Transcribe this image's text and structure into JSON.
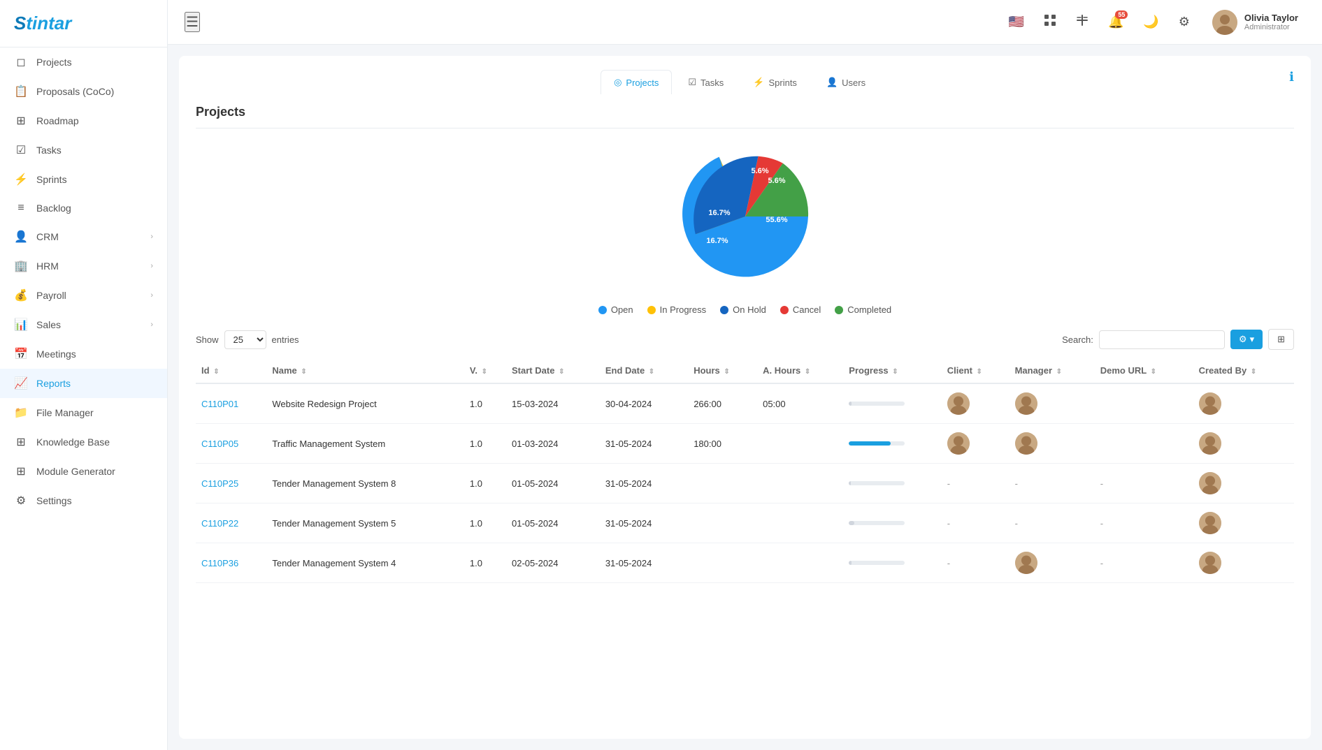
{
  "app": {
    "name": "Stintar"
  },
  "header": {
    "hamburger_label": "☰",
    "notification_count": "55",
    "user": {
      "name": "Olivia Taylor",
      "role": "Administrator"
    }
  },
  "sidebar": {
    "items": [
      {
        "id": "projects",
        "label": "Projects",
        "icon": "◻",
        "active": false
      },
      {
        "id": "proposals",
        "label": "Proposals (CoCo)",
        "icon": "📋",
        "active": false
      },
      {
        "id": "roadmap",
        "label": "Roadmap",
        "icon": "⊞",
        "active": false
      },
      {
        "id": "tasks",
        "label": "Tasks",
        "icon": "☑",
        "active": false
      },
      {
        "id": "sprints",
        "label": "Sprints",
        "icon": "⚡",
        "active": false
      },
      {
        "id": "backlog",
        "label": "Backlog",
        "icon": "≡",
        "active": false
      },
      {
        "id": "crm",
        "label": "CRM",
        "icon": "👤",
        "hasChevron": true,
        "active": false
      },
      {
        "id": "hrm",
        "label": "HRM",
        "icon": "🏢",
        "hasChevron": true,
        "active": false
      },
      {
        "id": "payroll",
        "label": "Payroll",
        "icon": "💰",
        "hasChevron": true,
        "active": false
      },
      {
        "id": "sales",
        "label": "Sales",
        "icon": "📊",
        "hasChevron": true,
        "active": false
      },
      {
        "id": "meetings",
        "label": "Meetings",
        "icon": "📅",
        "active": false
      },
      {
        "id": "reports",
        "label": "Reports",
        "icon": "📈",
        "active": true
      },
      {
        "id": "file-manager",
        "label": "File Manager",
        "icon": "📁",
        "active": false
      },
      {
        "id": "knowledge-base",
        "label": "Knowledge Base",
        "icon": "⊞",
        "active": false
      },
      {
        "id": "module-generator",
        "label": "Module Generator",
        "icon": "⊞",
        "active": false
      },
      {
        "id": "settings",
        "label": "Settings",
        "icon": "⚙",
        "active": false
      }
    ]
  },
  "tabs": [
    {
      "id": "projects",
      "label": "Projects",
      "icon": "◎",
      "active": true
    },
    {
      "id": "tasks",
      "label": "Tasks",
      "icon": "☑",
      "active": false
    },
    {
      "id": "sprints",
      "label": "Sprints",
      "icon": "⚡",
      "active": false
    },
    {
      "id": "users",
      "label": "Users",
      "icon": "👤",
      "active": false
    }
  ],
  "section": {
    "title": "Projects"
  },
  "chart": {
    "segments": [
      {
        "label": "Open",
        "percent": 55.6,
        "color": "#2196f3"
      },
      {
        "label": "In Progress",
        "percent": 16.7,
        "color": "#ffc107"
      },
      {
        "label": "On Hold",
        "percent": 16.7,
        "color": "#1565c0"
      },
      {
        "label": "Cancel",
        "percent": 5.6,
        "color": "#e53935"
      },
      {
        "label": "Completed",
        "percent": 5.6,
        "color": "#43a047"
      }
    ]
  },
  "table": {
    "show_label": "Show",
    "show_value": "25",
    "entries_label": "entries",
    "search_label": "Search:",
    "search_placeholder": "",
    "columns": [
      "Id",
      "Name",
      "V.",
      "Start Date",
      "End Date",
      "Hours",
      "A. Hours",
      "Progress",
      "Client",
      "Manager",
      "Demo URL",
      "Created By"
    ],
    "rows": [
      {
        "id": "C110P01",
        "name": "Website Redesign Project",
        "v": "1.0",
        "start": "15-03-2024",
        "end": "30-04-2024",
        "hours": "266:00",
        "a_hours": "05:00",
        "progress": 5,
        "has_client": true,
        "has_manager": true,
        "demo_url": "",
        "has_created": true
      },
      {
        "id": "C110P05",
        "name": "Traffic Management System",
        "v": "1.0",
        "start": "01-03-2024",
        "end": "31-05-2024",
        "hours": "180:00",
        "a_hours": "",
        "progress": 75,
        "progress_color": "#1a9fe0",
        "has_client": true,
        "has_manager": true,
        "demo_url": "",
        "has_created": true
      },
      {
        "id": "C110P25",
        "name": "Tender Management System 8",
        "v": "1.0",
        "start": "01-05-2024",
        "end": "31-05-2024",
        "hours": "",
        "a_hours": "",
        "progress": 3,
        "has_client": false,
        "has_manager": false,
        "demo_url": "-",
        "has_created": true
      },
      {
        "id": "C110P22",
        "name": "Tender Management System 5",
        "v": "1.0",
        "start": "01-05-2024",
        "end": "31-05-2024",
        "hours": "",
        "a_hours": "",
        "progress": 10,
        "has_client": false,
        "has_manager": false,
        "demo_url": "-",
        "has_created": true
      },
      {
        "id": "C110P36",
        "name": "Tender Management System 4",
        "v": "1.0",
        "start": "02-05-2024",
        "end": "31-05-2024",
        "hours": "",
        "a_hours": "",
        "progress": 5,
        "has_client": false,
        "has_manager": true,
        "demo_url": "-",
        "has_created": true
      }
    ],
    "in_progress_label": "In Progress"
  }
}
